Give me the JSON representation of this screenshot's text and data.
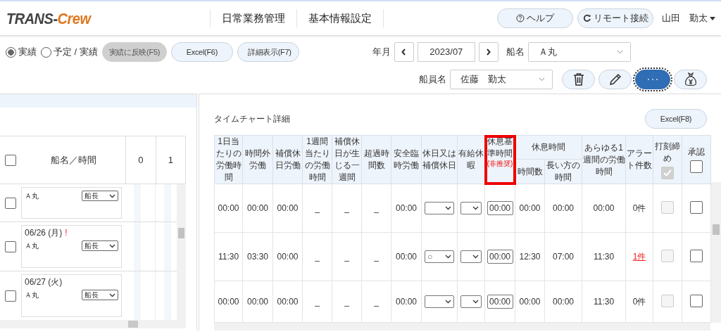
{
  "header": {
    "logo": {
      "main": "TRANS-",
      "accent": "Crew"
    },
    "nav": [
      {
        "label": "日常業務管理"
      },
      {
        "label": "基本情報設定"
      }
    ],
    "help": "ヘルプ",
    "remote": "リモート接続",
    "user": "山田　勤太"
  },
  "toolbar": {
    "modes": [
      {
        "label": "実績",
        "selected": true
      },
      {
        "label": "予定 / 実績",
        "selected": false
      }
    ],
    "buttons": [
      {
        "label": "実績に反映(F5)",
        "disabled": true
      },
      {
        "label": "Excel(F6)",
        "disabled": false
      },
      {
        "label": "詳細表示(F7)",
        "disabled": false
      }
    ],
    "month_label": "年月",
    "month": "2023/07",
    "ship_label": "船名",
    "ship": "Ａ丸",
    "crew_label": "船員名",
    "crew": "佐藤　勤太"
  },
  "left": {
    "header": "船名／時間",
    "all_checked": false,
    "hours": [
      "0",
      "1"
    ],
    "rows": [
      {
        "ship": "Ａ丸",
        "role": "船長",
        "checked": false
      },
      {
        "date": "06/26 (月)",
        "flag": "!",
        "ship": "Ａ丸",
        "role": "船長",
        "checked": false
      },
      {
        "date": "06/27 (火)",
        "ship": "Ａ丸",
        "role": "船長",
        "checked": false
      }
    ]
  },
  "detail": {
    "title": "タイムチャート詳細",
    "excel": "Excel(F8)",
    "columns": [
      {
        "label": "1日当たりの労働時間"
      },
      {
        "label": "時間外労働"
      },
      {
        "label": "補償休日労働"
      },
      {
        "label": "1週間当たりの労働時間"
      },
      {
        "label": "補償休日が生じる一週間"
      },
      {
        "label": "超過時間数"
      },
      {
        "label": "安全臨時労働"
      },
      {
        "label": "休日又は補償休日"
      },
      {
        "label": "有給休暇"
      },
      {
        "label": "休息基準時間",
        "note": "(非推奨)",
        "highlighted": true
      },
      {
        "label": "休息時間",
        "colspan": 2,
        "children": [
          {
            "label": "時間数"
          },
          {
            "label": "長い方の時間"
          }
        ]
      },
      {
        "label": "あらゆる1週間の労働時間"
      },
      {
        "label": "アラート件数"
      },
      {
        "label": "打刻締め",
        "kind": "checkbox",
        "checked": true,
        "disabled": true
      },
      {
        "label": "承認",
        "kind": "checkbox",
        "checked": false,
        "disabled": false
      }
    ],
    "rows": [
      {
        "cells": [
          {
            "kind": "text",
            "text": "00:00"
          },
          {
            "kind": "text",
            "text": "00:00"
          },
          {
            "kind": "text",
            "text": "00:00"
          },
          {
            "kind": "text",
            "text": "_"
          },
          {
            "kind": "text",
            "text": "_"
          },
          {
            "kind": "text",
            "text": "_"
          },
          {
            "kind": "text",
            "text": "00:00"
          },
          {
            "kind": "select"
          },
          {
            "kind": "select"
          },
          {
            "kind": "input",
            "value": "00:00"
          },
          {
            "kind": "text",
            "text": "00:00"
          },
          {
            "kind": "text",
            "text": "00:00"
          },
          {
            "kind": "text",
            "text": "00:00"
          },
          {
            "kind": "alert",
            "text": "0件",
            "alert": false
          },
          {
            "kind": "checkbox",
            "checked": false,
            "disabled": true
          },
          {
            "kind": "checkbox",
            "checked": false,
            "disabled": false
          }
        ]
      },
      {
        "cells": [
          {
            "kind": "text",
            "text": "11:30"
          },
          {
            "kind": "text",
            "text": "03:30"
          },
          {
            "kind": "text",
            "text": "00:00"
          },
          {
            "kind": "text",
            "text": "_"
          },
          {
            "kind": "text",
            "text": "_"
          },
          {
            "kind": "text",
            "text": "_"
          },
          {
            "kind": "text",
            "text": "00:00"
          },
          {
            "kind": "select",
            "value": "○"
          },
          {
            "kind": "select"
          },
          {
            "kind": "input",
            "value": "00:00"
          },
          {
            "kind": "text",
            "text": "12:30"
          },
          {
            "kind": "text",
            "text": "07:00"
          },
          {
            "kind": "text",
            "text": "11:30"
          },
          {
            "kind": "alert",
            "text": "1件",
            "alert": true
          },
          {
            "kind": "checkbox",
            "checked": false,
            "disabled": true
          },
          {
            "kind": "checkbox",
            "checked": false,
            "disabled": false
          }
        ]
      },
      {
        "cells": [
          {
            "kind": "text",
            "text": "00:00"
          },
          {
            "kind": "text",
            "text": "00:00"
          },
          {
            "kind": "text",
            "text": "00:00"
          },
          {
            "kind": "text",
            "text": "_"
          },
          {
            "kind": "text",
            "text": "_"
          },
          {
            "kind": "text",
            "text": "_"
          },
          {
            "kind": "text",
            "text": "00:00"
          },
          {
            "kind": "select"
          },
          {
            "kind": "select"
          },
          {
            "kind": "input",
            "value": "00:00"
          },
          {
            "kind": "text",
            "text": "00:00"
          },
          {
            "kind": "text",
            "text": "00:00"
          },
          {
            "kind": "text",
            "text": "11:30"
          },
          {
            "kind": "alert",
            "text": "0件",
            "alert": false
          },
          {
            "kind": "checkbox",
            "checked": false,
            "disabled": true
          },
          {
            "kind": "checkbox",
            "checked": false,
            "disabled": false
          }
        ]
      }
    ]
  }
}
